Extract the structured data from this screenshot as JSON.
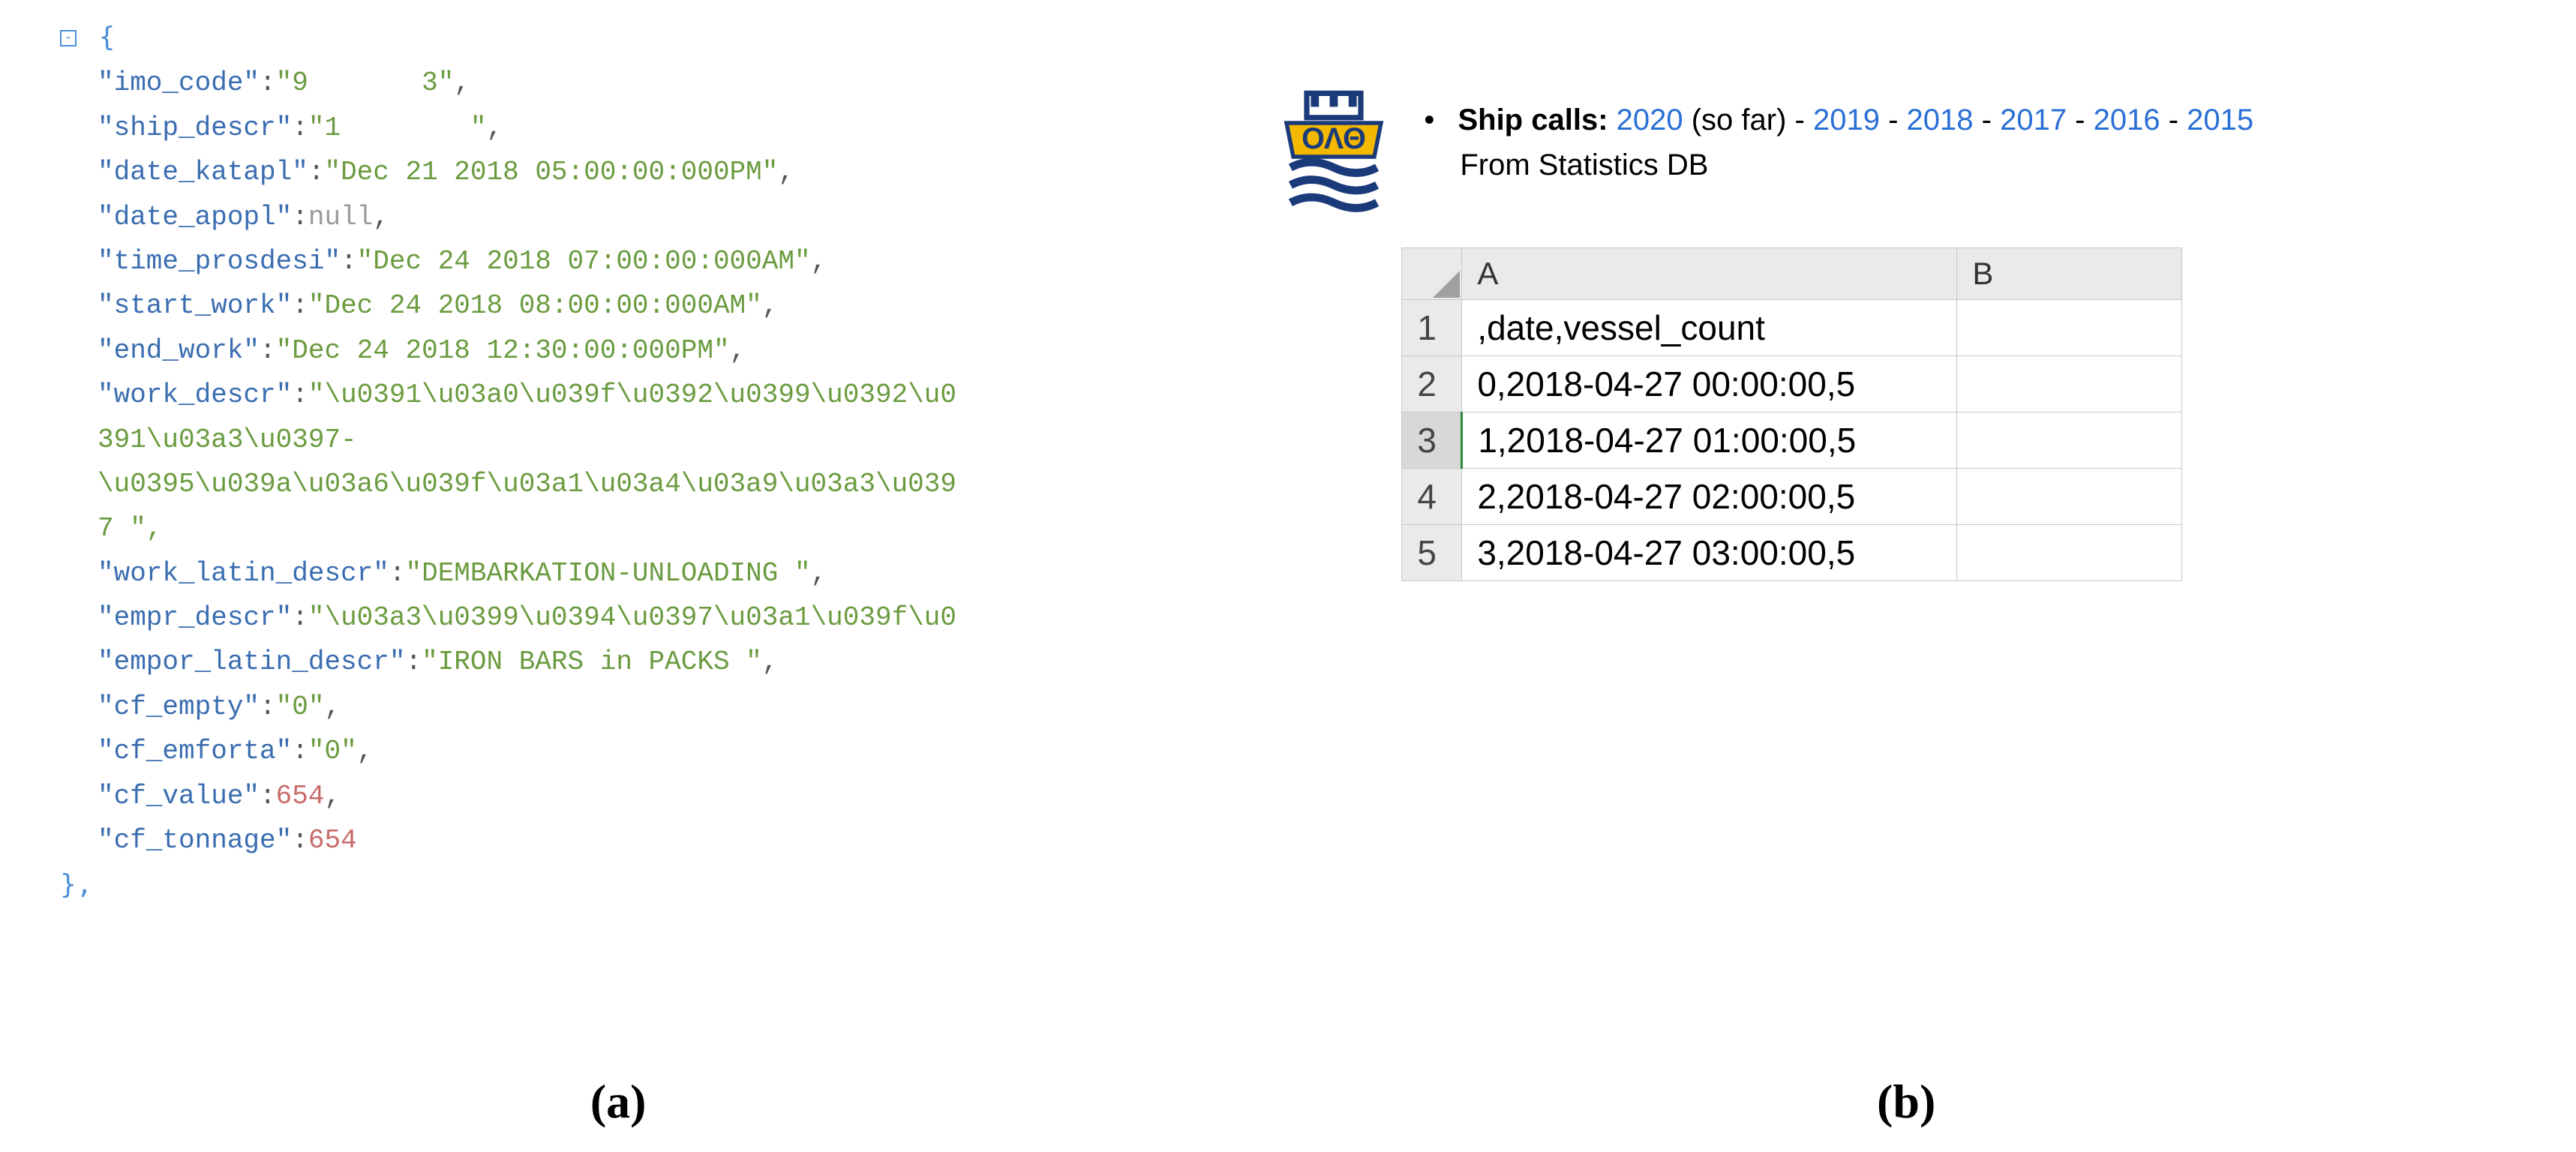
{
  "json_record": {
    "open": "{",
    "close": "},",
    "lines": [
      {
        "key": "\"imo_code\"",
        "sep": ":",
        "val": "\"9       3\"",
        "cls": "str",
        "comma": ","
      },
      {
        "key": "\"ship_descr\"",
        "sep": ":",
        "val": "\"1        \"",
        "cls": "str",
        "comma": ","
      },
      {
        "key": "\"date_katapl\"",
        "sep": ":",
        "val": "\"Dec 21 2018 05:00:00:000PM\"",
        "cls": "str",
        "comma": ","
      },
      {
        "key": "\"date_apopl\"",
        "sep": ":",
        "val": "null",
        "cls": "null",
        "comma": ","
      },
      {
        "key": "\"time_prosdesi\"",
        "sep": ":",
        "val": "\"Dec 24 2018 07:00:00:000AM\"",
        "cls": "str",
        "comma": ","
      },
      {
        "key": "\"start_work\"",
        "sep": ":",
        "val": "\"Dec 24 2018 08:00:00:000AM\"",
        "cls": "str",
        "comma": ","
      },
      {
        "key": "\"end_work\"",
        "sep": ":",
        "val": "\"Dec 24 2018 12:30:00:000PM\"",
        "cls": "str",
        "comma": ","
      },
      {
        "key": "\"work_descr\"",
        "sep": ":",
        "val": "\"\\u0391\\u03a0\\u039f\\u0392\\u0399\\u0392\\u0",
        "cls": "str",
        "comma": ""
      },
      {
        "cont": "391\\u03a3\\u0397-"
      },
      {
        "cont": "\\u0395\\u039a\\u03a6\\u039f\\u03a1\\u03a4\\u03a9\\u03a3\\u039"
      },
      {
        "cont": "7 \","
      },
      {
        "key": "\"work_latin_descr\"",
        "sep": ":",
        "val": "\"DEMBARKATION-UNLOADING \"",
        "cls": "str",
        "comma": ","
      },
      {
        "key": "\"empr_descr\"",
        "sep": ":",
        "val": "\"\\u03a3\\u0399\\u0394\\u0397\\u03a1\\u039f\\u0",
        "cls": "str",
        "comma": ""
      },
      {
        "key": "\"empor_latin_descr\"",
        "sep": ":",
        "val": "\"IRON BARS in PACKS \"",
        "cls": "str",
        "comma": ","
      },
      {
        "key": "\"cf_empty\"",
        "sep": ":",
        "val": "\"0\"",
        "cls": "str",
        "comma": ","
      },
      {
        "key": "\"cf_emforta\"",
        "sep": ":",
        "val": "\"0\"",
        "cls": "str",
        "comma": ","
      },
      {
        "key": "\"cf_value\"",
        "sep": ":",
        "val": "654",
        "cls": "num",
        "comma": ","
      },
      {
        "key": "\"cf_tonnage\"",
        "sep": ":",
        "val": "654",
        "cls": "num",
        "comma": ""
      }
    ]
  },
  "header": {
    "label": "Ship calls:",
    "years": [
      "2020",
      "2019",
      "2018",
      "2017",
      "2016",
      "2015"
    ],
    "note": "(so far)",
    "sep": "-",
    "subtitle": "From Statistics DB"
  },
  "sheet": {
    "col_headers": [
      "A",
      "B"
    ],
    "rows": [
      {
        "n": "1",
        "a": ",date,vessel_count",
        "b": ""
      },
      {
        "n": "2",
        "a": "0,2018-04-27 00:00:00,5",
        "b": ""
      },
      {
        "n": "3",
        "a": "1,2018-04-27 01:00:00,5",
        "b": "",
        "selected": true
      },
      {
        "n": "4",
        "a": "2,2018-04-27 02:00:00,5",
        "b": ""
      },
      {
        "n": "5",
        "a": "3,2018-04-27 03:00:00,5",
        "b": ""
      }
    ]
  },
  "captions": {
    "a": "(a)",
    "b": "(b)"
  }
}
